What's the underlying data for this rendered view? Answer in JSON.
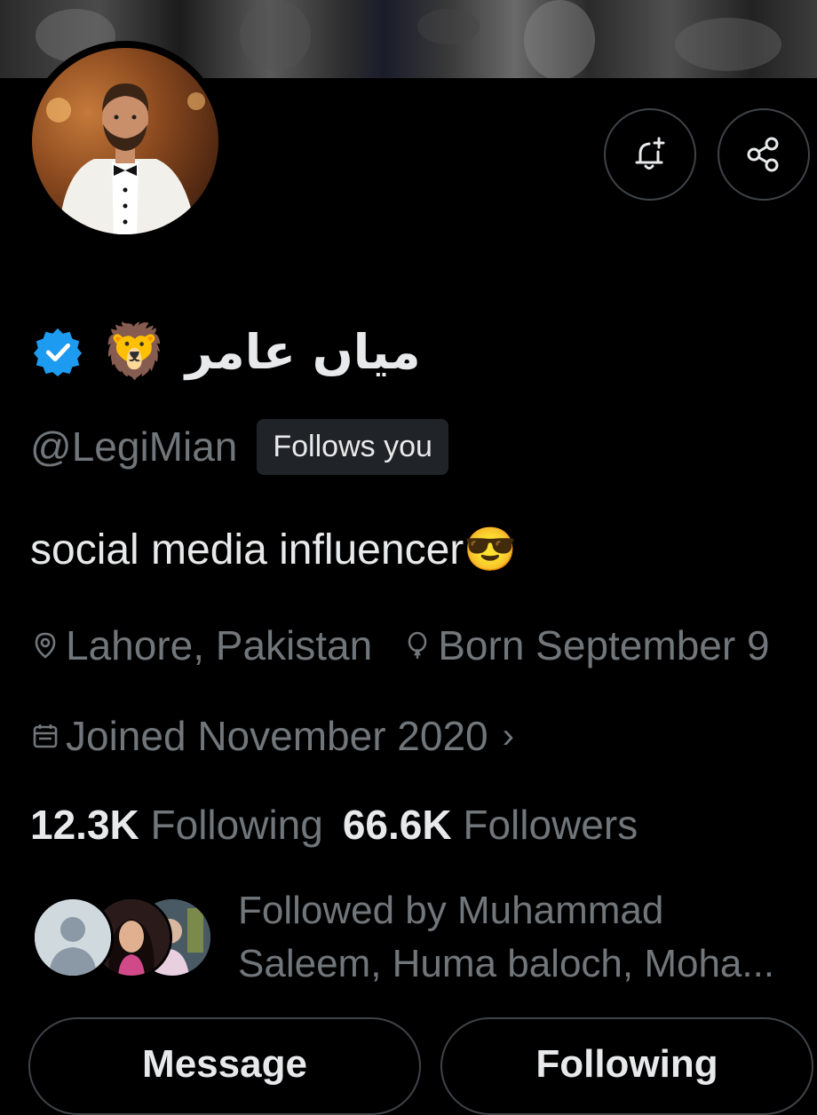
{
  "profile": {
    "display_name": "میاں عامر",
    "name_emoji": "🦁",
    "handle": "@LegiMian",
    "follows_you_label": "Follows you",
    "bio": "social media influencer😎",
    "location": "Lahore, Pakistan",
    "birthday": "Born September 9",
    "joined": "Joined November 2020",
    "joined_chevron": "›"
  },
  "stats": {
    "following_count": "12.3K",
    "following_label": "Following",
    "followers_count": "66.6K",
    "followers_label": "Followers"
  },
  "followed_by": {
    "line1": "Followed by Muhammad",
    "line2": "Saleem, Huma baloch, Moha..."
  },
  "actions": {
    "message_label": "Message",
    "following_label": "Following"
  },
  "icons": {
    "notification": "bell-plus-icon",
    "share": "share-icon",
    "verified": "verified-badge-icon",
    "location": "location-pin-icon",
    "birthday": "balloon-icon",
    "calendar": "calendar-icon"
  },
  "colors": {
    "background": "#000000",
    "primary_text": "#e7e9ea",
    "secondary_text": "#71767b",
    "verified_blue": "#1d9bf0",
    "border": "#3f4448"
  }
}
